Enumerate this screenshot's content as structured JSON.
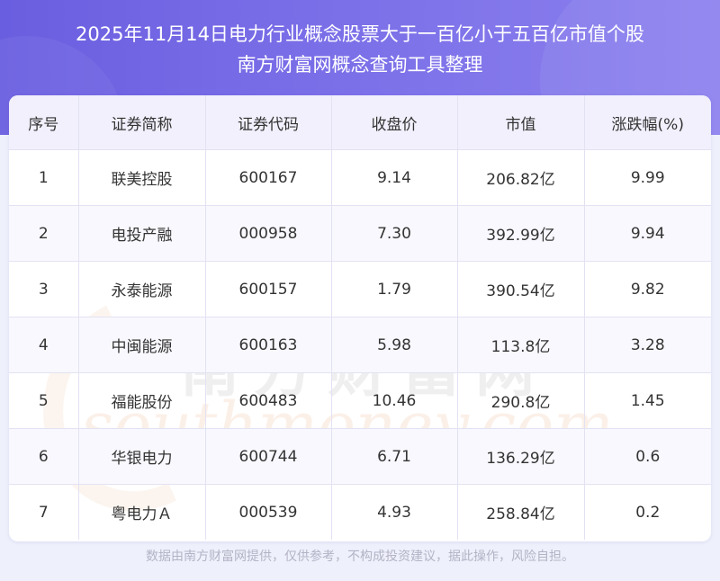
{
  "header": {
    "title_line1": "2025年11月14日电力行业概念股票大于一百亿小于五百亿市值个股",
    "title_line2": "南方财富网概念查询工具整理"
  },
  "table": {
    "columns": [
      "序号",
      "证券简称",
      "证券代码",
      "收盘价",
      "市值",
      "涨跌幅(%)"
    ],
    "rows": [
      [
        "1",
        "联美控股",
        "600167",
        "9.14",
        "206.82亿",
        "9.99"
      ],
      [
        "2",
        "电投产融",
        "000958",
        "7.30",
        "392.99亿",
        "9.94"
      ],
      [
        "3",
        "永泰能源",
        "600157",
        "1.79",
        "390.54亿",
        "9.82"
      ],
      [
        "4",
        "中闽能源",
        "600163",
        "5.98",
        "113.8亿",
        "3.28"
      ],
      [
        "5",
        "福能股份",
        "600483",
        "10.46",
        "290.8亿",
        "1.45"
      ],
      [
        "6",
        "华银电力",
        "600744",
        "6.71",
        "136.29亿",
        "0.6"
      ],
      [
        "7",
        "粤电力Ａ",
        "000539",
        "4.93",
        "258.84亿",
        "0.2"
      ]
    ]
  },
  "watermark": {
    "cn": "南方财富网",
    "en": "southmoney.com"
  },
  "footer": {
    "disclaimer": "数据由南方财富网提供，仅供参考，不构成投资建议，据此操作，风险自担。"
  },
  "colors": {
    "header_bg": "#7468e4",
    "header_text": "#ffffff",
    "page_bg": "#eef0fb",
    "table_head_bg": "#f1f0fc"
  }
}
